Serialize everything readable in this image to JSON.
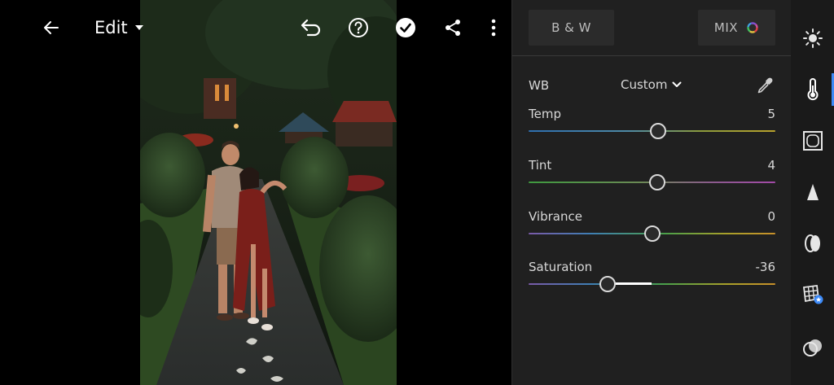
{
  "toolbar": {
    "back_icon": "arrow-left-icon",
    "edit_label": "Edit",
    "edit_dropdown_icon": "caret-down-icon",
    "undo_icon": "undo-icon",
    "help_icon": "help-circle-icon",
    "done_icon": "check-circle-icon",
    "share_icon": "share-icon",
    "more_icon": "more-vertical-icon"
  },
  "panel": {
    "bw_label": "B & W",
    "mix_label": "MIX",
    "wb": {
      "label": "WB",
      "value": "Custom",
      "dropdown_icon": "chevron-down-icon",
      "picker_icon": "eyedropper-icon"
    },
    "sliders": [
      {
        "key": "temp",
        "label": "Temp",
        "value": "5",
        "level": 0.525
      },
      {
        "key": "tint",
        "label": "Tint",
        "value": "4",
        "level": 0.52
      },
      {
        "key": "vibrance",
        "label": "Vibrance",
        "value": "0",
        "level": 0.5
      },
      {
        "key": "saturation",
        "label": "Saturation",
        "value": "-36",
        "level": 0.32
      }
    ]
  },
  "rail": {
    "items": [
      {
        "name": "light",
        "icon": "sun-icon",
        "active": false
      },
      {
        "name": "color",
        "icon": "thermometer-icon",
        "active": true
      },
      {
        "name": "effects",
        "icon": "vignette-icon",
        "active": false
      },
      {
        "name": "detail",
        "icon": "triangle-icon",
        "active": false
      },
      {
        "name": "optics",
        "icon": "lens-icon",
        "active": false
      },
      {
        "name": "geometry",
        "icon": "grid-transform-icon",
        "active": false
      },
      {
        "name": "presets",
        "icon": "overlap-circles-icon",
        "active": false
      }
    ]
  },
  "colors": {
    "panel_bg": "#202020",
    "rail_bg": "#1a1a1a",
    "accent": "#3d8af7"
  }
}
